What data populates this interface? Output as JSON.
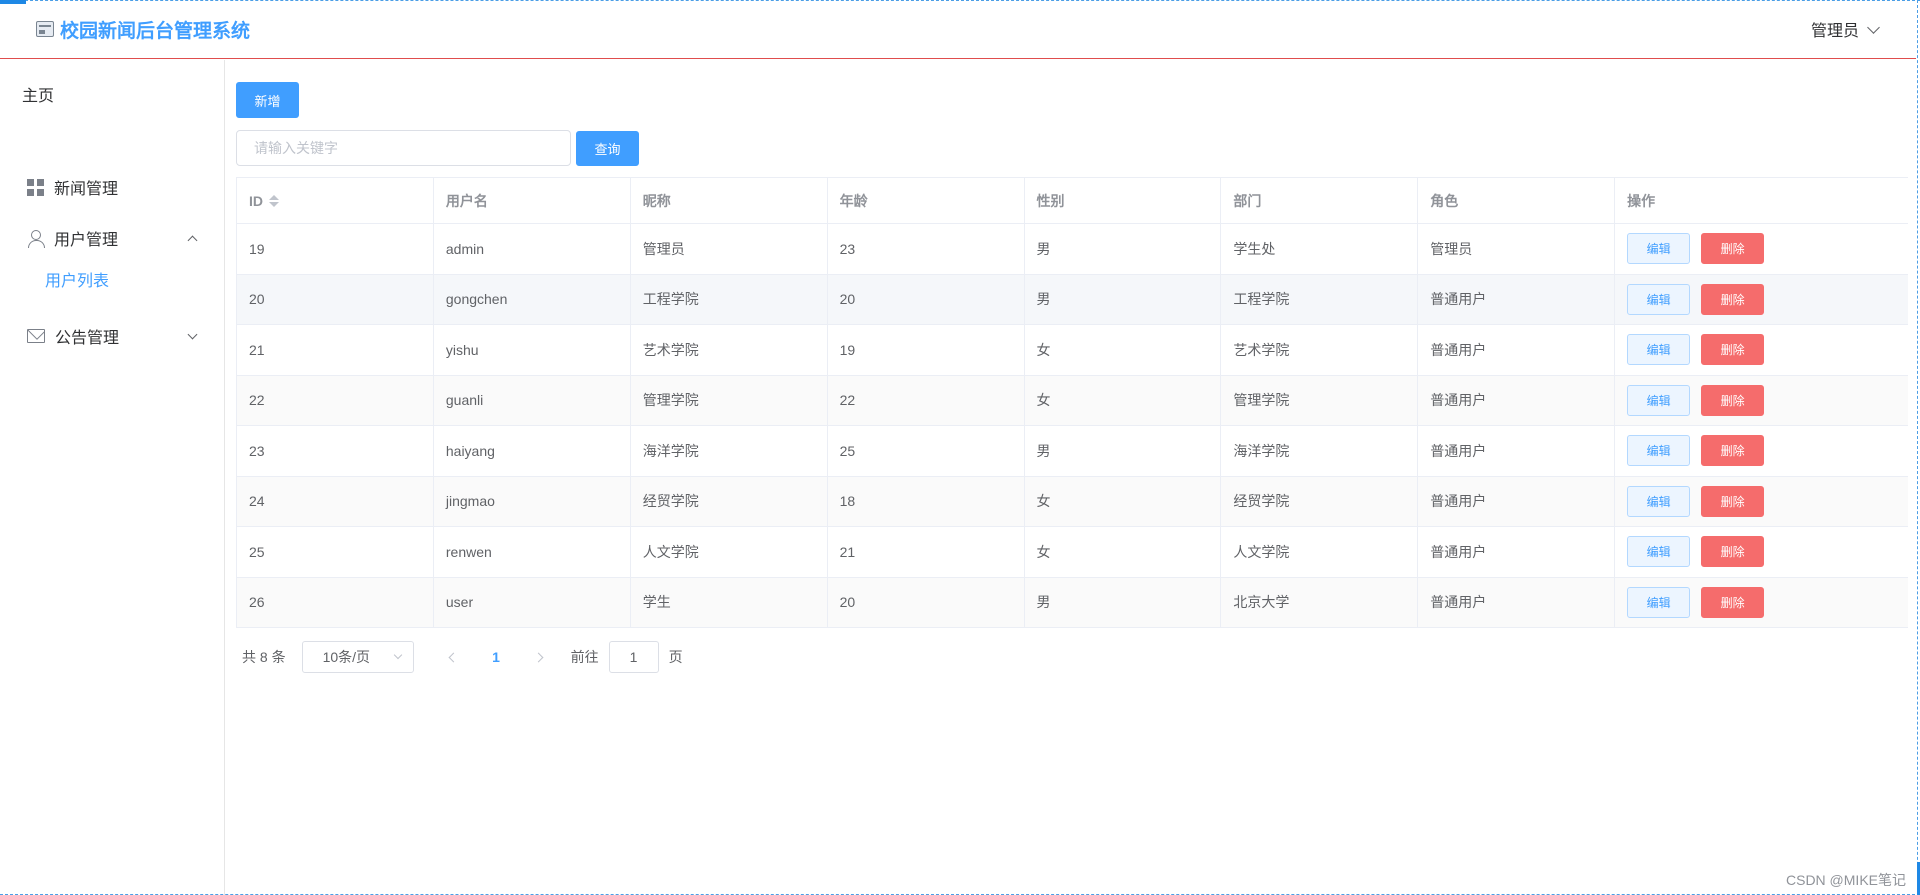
{
  "header": {
    "title": "校园新闻后台管理系统",
    "user_label": "管理员"
  },
  "sidebar": {
    "home": "主页",
    "items": [
      {
        "label": "新闻管理",
        "icon": "grid-icon"
      },
      {
        "label": "用户管理",
        "icon": "user-icon",
        "expanded": true,
        "children": [
          {
            "label": "用户列表",
            "active": true
          }
        ]
      },
      {
        "label": "公告管理",
        "icon": "mail-icon",
        "expanded": false
      }
    ]
  },
  "toolbar": {
    "add_label": "新增",
    "search_placeholder": "请输入关键字",
    "search_value": "",
    "query_label": "查询"
  },
  "table": {
    "columns": [
      "ID",
      "用户名",
      "昵称",
      "年龄",
      "性别",
      "部门",
      "角色",
      "操作"
    ],
    "edit_label": "编辑",
    "delete_label": "删除",
    "rows": [
      [
        "19",
        "admin",
        "管理员",
        "23",
        "男",
        "学生处",
        "管理员"
      ],
      [
        "20",
        "gongchen",
        "工程学院",
        "20",
        "男",
        "工程学院",
        "普通用户"
      ],
      [
        "21",
        "yishu",
        "艺术学院",
        "19",
        "女",
        "艺术学院",
        "普通用户"
      ],
      [
        "22",
        "guanli",
        "管理学院",
        "22",
        "女",
        "管理学院",
        "普通用户"
      ],
      [
        "23",
        "haiyang",
        "海洋学院",
        "25",
        "男",
        "海洋学院",
        "普通用户"
      ],
      [
        "24",
        "jingmao",
        "经贸学院",
        "18",
        "女",
        "经贸学院",
        "普通用户"
      ],
      [
        "25",
        "renwen",
        "人文学院",
        "21",
        "女",
        "人文学院",
        "普通用户"
      ],
      [
        "26",
        "user",
        "学生",
        "20",
        "男",
        "北京大学",
        "普通用户"
      ]
    ]
  },
  "pagination": {
    "total_text": "共 8 条",
    "page_size": "10条/页",
    "current_page": "1",
    "goto_label": "前往",
    "goto_value": "1",
    "page_suffix": "页"
  },
  "watermark": "CSDN @MIKE笔记",
  "colors": {
    "primary": "#409eff",
    "danger": "#f56c6c",
    "header_border": "#e04d4d"
  }
}
